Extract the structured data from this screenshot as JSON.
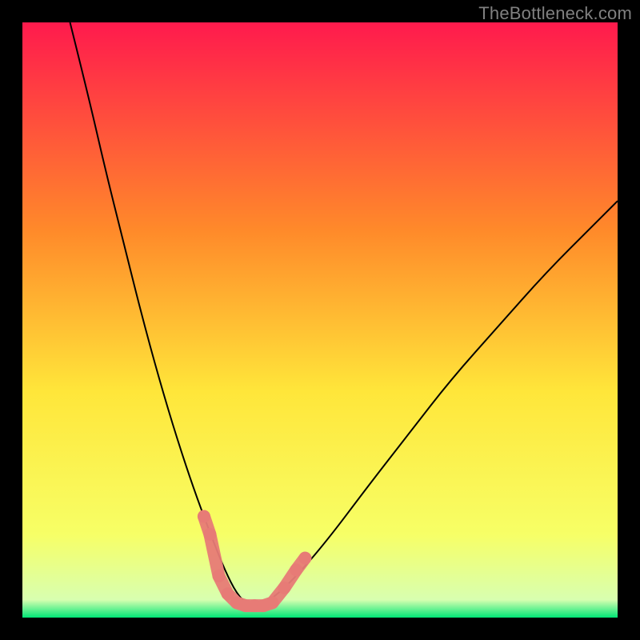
{
  "watermark": "TheBottleneck.com",
  "chart_data": {
    "type": "line",
    "title": "",
    "xlabel": "",
    "ylabel": "",
    "xlim": [
      0,
      100
    ],
    "ylim": [
      0,
      100
    ],
    "background": {
      "gradient_from": "#ff1a4d",
      "gradient_mid1": "#ff8a2a",
      "gradient_mid2": "#ffe63a",
      "gradient_mid3": "#f7ff66",
      "gradient_to": "#00e676",
      "border_color": "#000000",
      "border_width": 4
    },
    "series": [
      {
        "name": "curve-left",
        "color": "#000000",
        "width": 2,
        "x": [
          8,
          11,
          14,
          17,
          20,
          23,
          26,
          29,
          32,
          34,
          36,
          38
        ],
        "y": [
          100,
          88,
          75,
          63,
          51,
          40,
          30,
          21,
          13,
          8,
          4,
          2
        ]
      },
      {
        "name": "curve-right",
        "color": "#000000",
        "width": 2,
        "x": [
          38,
          40,
          43,
          47,
          52,
          58,
          65,
          72,
          80,
          88,
          96,
          100
        ],
        "y": [
          2,
          2,
          4,
          8,
          14,
          22,
          31,
          40,
          49,
          58,
          66,
          70
        ]
      }
    ],
    "markers": {
      "color": "#e77b76",
      "radius": 8,
      "points": [
        {
          "x": 30.5,
          "y": 17
        },
        {
          "x": 31.5,
          "y": 14
        },
        {
          "x": 33.0,
          "y": 7
        },
        {
          "x": 34.5,
          "y": 4
        },
        {
          "x": 36.0,
          "y": 2.5
        },
        {
          "x": 37.5,
          "y": 2
        },
        {
          "x": 39.0,
          "y": 2
        },
        {
          "x": 40.5,
          "y": 2
        },
        {
          "x": 42.0,
          "y": 2.5
        },
        {
          "x": 44.0,
          "y": 5
        },
        {
          "x": 46.0,
          "y": 8
        },
        {
          "x": 47.5,
          "y": 10
        }
      ]
    }
  }
}
